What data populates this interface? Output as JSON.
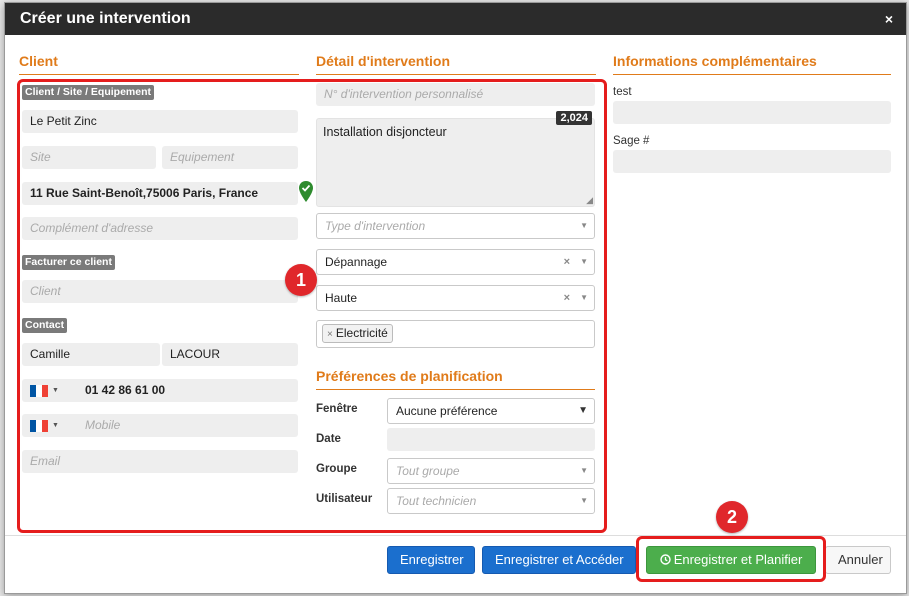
{
  "modal": {
    "title": "Créer une intervention",
    "close": "×"
  },
  "client": {
    "section_title": "Client",
    "label_cse": "Client / Site / Equipement",
    "client_name": "Le Petit Zinc",
    "site_placeholder": "Site",
    "equipment_placeholder": "Equipement",
    "address": "11 Rue Saint-Benoît,75006 Paris, France",
    "address_complement_placeholder": "Complément d'adresse",
    "label_bill": "Facturer ce client",
    "bill_client_placeholder": "Client",
    "label_contact": "Contact",
    "first_name": "Camille",
    "last_name": "LACOUR",
    "phone": "01 42 86 61 00",
    "mobile_placeholder": "Mobile",
    "email_placeholder": "Email"
  },
  "detail": {
    "section_title": "Détail d'intervention",
    "custom_number_placeholder": "N° d'intervention personnalisé",
    "description": "Installation disjoncteur",
    "char_counter": "2,024",
    "type_placeholder": "Type d'intervention",
    "category": "Dépannage",
    "priority": "Haute",
    "tag": "Electricité"
  },
  "planning": {
    "section_title": "Préférences de planification",
    "window_label": "Fenêtre",
    "window_value": "Aucune préférence",
    "date_label": "Date",
    "group_label": "Groupe",
    "group_placeholder": "Tout groupe",
    "user_label": "Utilisateur",
    "user_placeholder": "Tout technicien"
  },
  "extra": {
    "section_title": "Informations complémentaires",
    "test_label": "test",
    "sage_label": "Sage #"
  },
  "footer": {
    "save": "Enregistrer",
    "save_access": "Enregistrer et Accéder",
    "save_plan": "Enregistrer et Planifier",
    "cancel": "Annuler"
  },
  "annotations": {
    "badge_1": "1",
    "badge_2": "2"
  },
  "colors": {
    "accent_orange": "#e07b1a",
    "primary_blue": "#1b6fce",
    "success_green": "#4cae4c",
    "highlight_red": "#e51d1d"
  },
  "icons": {
    "close": "close-icon",
    "check": "check-marker-icon",
    "clock": "clock-icon",
    "flag": "france-flag-icon"
  }
}
